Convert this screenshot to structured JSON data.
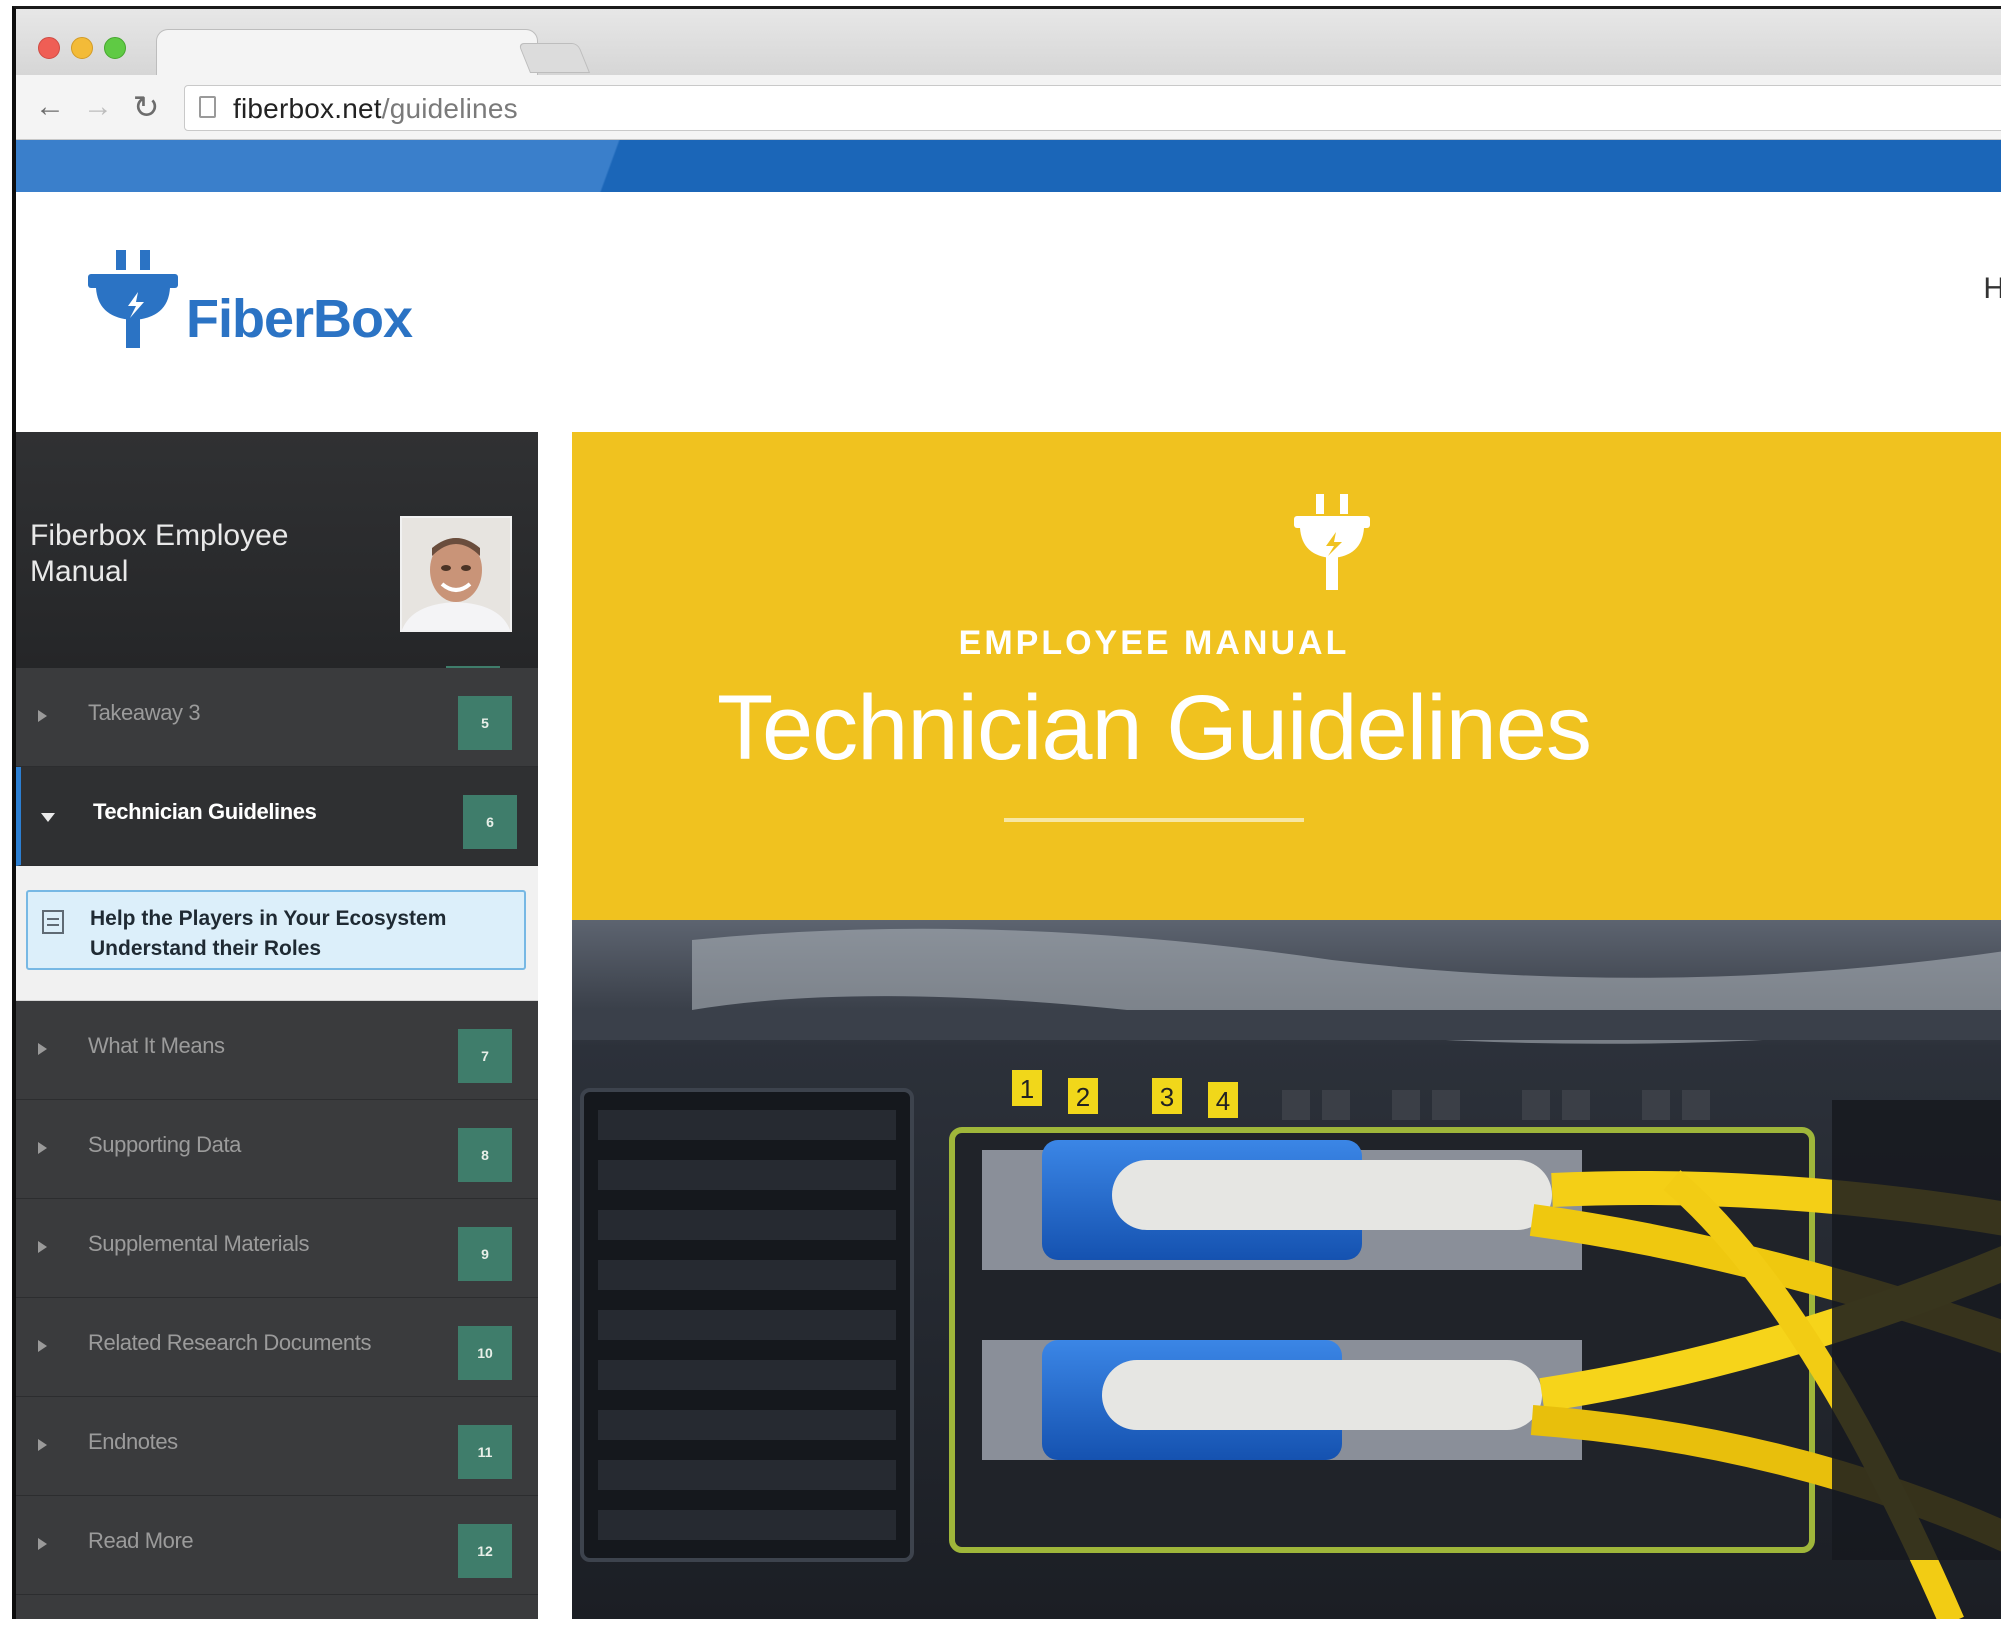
{
  "browser": {
    "url_domain": "fiberbox.net",
    "url_path": "/guidelines"
  },
  "site": {
    "logo_text": "FiberBox",
    "nav_peek": "H"
  },
  "sidebar": {
    "title": "Fiberbox Employee Manual",
    "items": [
      {
        "label": "Takeaway 3",
        "badge": "5"
      },
      {
        "label": "Technician Guidelines",
        "badge": "6"
      },
      {
        "label": "What It Means",
        "badge": "7"
      },
      {
        "label": "Supporting Data",
        "badge": "8"
      },
      {
        "label": "Supplemental Materials",
        "badge": "9"
      },
      {
        "label": "Related Research Documents",
        "badge": "10"
      },
      {
        "label": "Endnotes",
        "badge": "11"
      },
      {
        "label": "Read More",
        "badge": "12"
      }
    ],
    "subitem": "Help the Players in Your Ecosystem Understand their Roles"
  },
  "hero": {
    "kicker": "EMPLOYEE MANUAL",
    "title": "Technician Guidelines",
    "port_labels": [
      "1",
      "2",
      "3",
      "4"
    ]
  },
  "colors": {
    "brand_blue": "#2b73c4",
    "hero_yellow": "#f0c21f",
    "badge_green": "#3f7d6b",
    "sidebar_dark": "#3a3b3d"
  }
}
